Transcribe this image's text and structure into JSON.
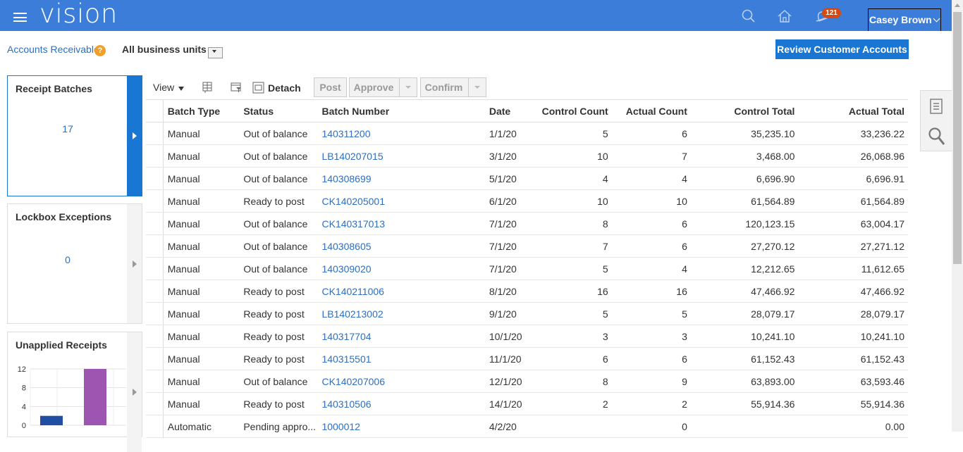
{
  "header": {
    "app_name": "vision",
    "notification_count": "121",
    "user_name": "Casey Brown",
    "icons": [
      "menu-icon",
      "search-icon",
      "home-icon",
      "notifications-icon"
    ],
    "background_color": "#3b7dd8"
  },
  "subheader": {
    "breadcrumb": "Accounts Receivable",
    "help_glyph": "?",
    "business_unit": "All business units",
    "review_button": "Review Customer Accounts"
  },
  "tiles": [
    {
      "title": "Receipt Batches",
      "count": "17",
      "selected": true
    },
    {
      "title": "Lockbox Exceptions",
      "count": "0",
      "selected": false
    },
    {
      "title": "Unapplied Receipts",
      "selected": false
    }
  ],
  "chart_data": {
    "type": "bar",
    "title": "Unapplied Receipts",
    "y_ticks": [
      "12",
      "8",
      "4",
      "0"
    ],
    "ylim": [
      0,
      12
    ],
    "grid": true,
    "bars": [
      {
        "value": 2,
        "color": "#1f4ea3"
      },
      {
        "value": 12,
        "color": "#9c55b0"
      }
    ]
  },
  "toolbar": {
    "view_label": "View",
    "detach_label": "Detach",
    "post_label": "Post",
    "approve_label": "Approve",
    "confirm_label": "Confirm"
  },
  "table": {
    "columns": [
      "Batch Type",
      "Status",
      "Batch Number",
      "Date",
      "Control Count",
      "Actual Count",
      "Control Total",
      "Actual Total"
    ],
    "rows": [
      [
        "Manual",
        "Out of balance",
        "140311200",
        "1/1/20",
        "5",
        "6",
        "35,235.10",
        "33,236.22"
      ],
      [
        "Manual",
        "Out of balance",
        "LB140207015",
        "3/1/20",
        "10",
        "7",
        "3,468.00",
        "26,068.96"
      ],
      [
        "Manual",
        "Out of balance",
        "140308699",
        "5/1/20",
        "4",
        "4",
        "6,696.90",
        "6,696.91"
      ],
      [
        "Manual",
        "Ready to post",
        "CK140205001",
        "6/1/20",
        "10",
        "10",
        "61,564.89",
        "61,564.89"
      ],
      [
        "Manual",
        "Out of balance",
        "CK140317013",
        "7/1/20",
        "8",
        "6",
        "120,123.15",
        "63,004.17"
      ],
      [
        "Manual",
        "Out of balance",
        "140308605",
        "7/1/20",
        "7",
        "6",
        "27,270.12",
        "27,271.12"
      ],
      [
        "Manual",
        "Out of balance",
        "140309020",
        "7/1/20",
        "5",
        "4",
        "12,212.65",
        "11,612.65"
      ],
      [
        "Manual",
        "Ready to post",
        "CK140211006",
        "8/1/20",
        "16",
        "16",
        "47,466.92",
        "47,466.92"
      ],
      [
        "Manual",
        "Ready to post",
        "LB140213002",
        "9/1/20",
        "5",
        "5",
        "28,079.17",
        "28,079.17"
      ],
      [
        "Manual",
        "Ready to post",
        "140317704",
        "10/1/20",
        "3",
        "3",
        "10,241.10",
        "10,241.10"
      ],
      [
        "Manual",
        "Ready to post",
        "140315501",
        "11/1/20",
        "6",
        "6",
        "61,152.43",
        "61,152.43"
      ],
      [
        "Manual",
        "Out of balance",
        "CK140207006",
        "12/1/20",
        "8",
        "9",
        "63,893.00",
        "63,593.46"
      ],
      [
        "Manual",
        "Ready to post",
        "140310506",
        "14/1/20",
        "2",
        "2",
        "55,914.36",
        "55,914.36"
      ],
      [
        "Automatic",
        "Pending appro...",
        "1000012",
        "4/2/20",
        "",
        "0",
        "",
        "0.00"
      ]
    ]
  },
  "side_panel": {
    "icons": [
      "document-icon",
      "search-panel-icon"
    ]
  }
}
